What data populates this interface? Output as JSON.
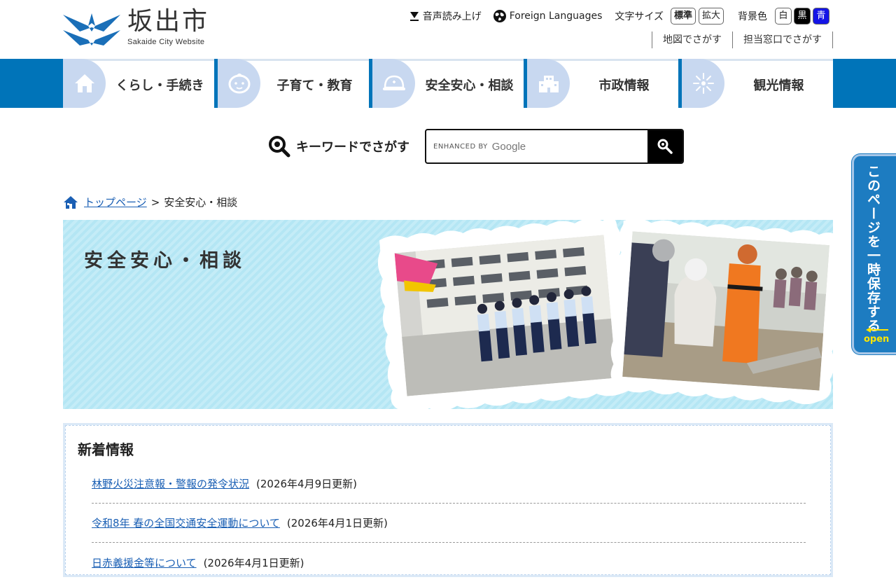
{
  "header": {
    "logo_title": "坂出市",
    "logo_sub": "Sakaide City Website",
    "utility": {
      "voice": "音声読み上げ",
      "foreign": "Foreign Languages",
      "font_size_label": "文字サイズ",
      "font_standard": "標準",
      "font_large": "拡大",
      "bg_label": "背景色",
      "bg_white": "白",
      "bg_black": "黒",
      "bg_blue": "青"
    },
    "links": {
      "map": "地図でさがす",
      "counter": "担当窓口でさがす"
    }
  },
  "nav": {
    "items": [
      {
        "label": "くらし・手続き",
        "icon": "house-icon"
      },
      {
        "label": "子育て・教育",
        "icon": "baby-icon"
      },
      {
        "label": "安全安心・相談",
        "icon": "helmet-icon"
      },
      {
        "label": "市政情報",
        "icon": "building-icon"
      },
      {
        "label": "観光情報",
        "icon": "firework-icon"
      }
    ]
  },
  "search": {
    "label": "キーワードでさがす",
    "enhanced_by": "ENHANCED BY",
    "google": "Google"
  },
  "side_tab": {
    "text": "このページを一時保存する",
    "open": "open"
  },
  "breadcrumb": {
    "home": "トップページ",
    "separator": ">",
    "current": "安全安心・相談"
  },
  "hero": {
    "title": "安全安心・相談"
  },
  "news": {
    "title": "新着情報",
    "items": [
      {
        "title": "林野火災注意報・警報の発令状況",
        "date": "(2026年4月9日更新)"
      },
      {
        "title": "令和8年 春の全国交通安全運動について",
        "date": "(2026年4月1日更新)"
      },
      {
        "title": "日赤義援金等について",
        "date": "(2026年4月1日更新)"
      }
    ]
  },
  "colors": {
    "nav_blue": "#0074b9",
    "nav_icon_bg": "#c8d8f0",
    "hero_bg": "#b4e6f4",
    "link": "#1a5fb4",
    "side_tab": "#1d7cc1",
    "open_yellow": "#ffe600"
  }
}
